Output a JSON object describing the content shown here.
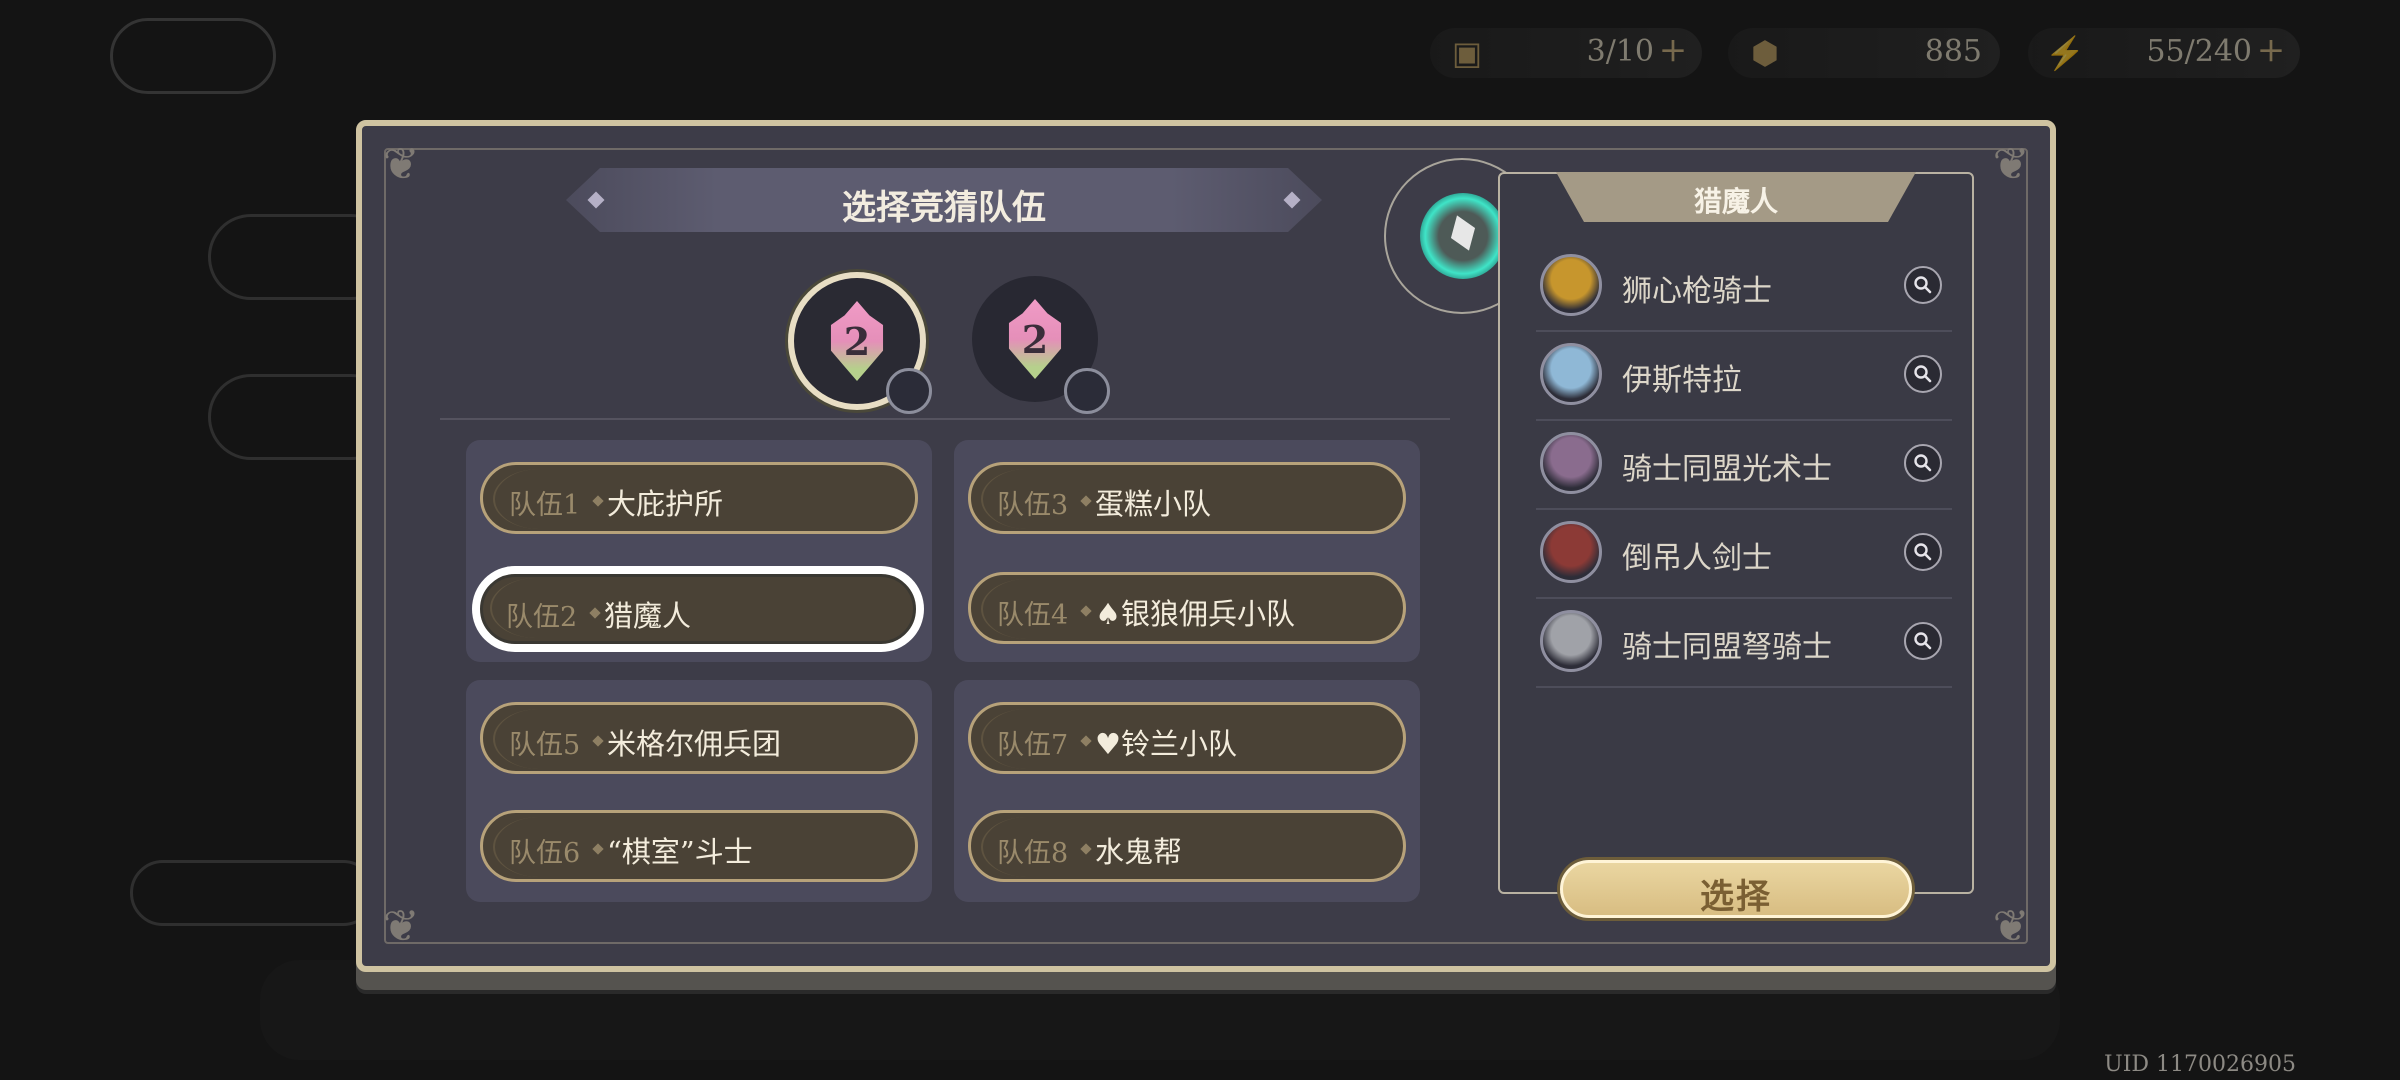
{
  "title": "选择竞猜队伍",
  "resources": [
    {
      "icon": "card-icon",
      "value": "3/10"
    },
    {
      "icon": "coin-icon",
      "value": "885"
    },
    {
      "icon": "lightning-icon",
      "value": "55/240"
    }
  ],
  "badges": [
    {
      "number": "2"
    },
    {
      "number": "2"
    }
  ],
  "teams": [
    {
      "no": "队伍1",
      "name": "大庇护所"
    },
    {
      "no": "队伍2",
      "name": "猎魔人"
    },
    {
      "no": "队伍3",
      "name": "蛋糕小队"
    },
    {
      "no": "队伍4",
      "name": "♠银狼佣兵小队"
    },
    {
      "no": "队伍5",
      "name": "米格尔佣兵团"
    },
    {
      "no": "队伍6",
      "name": "“棋室”斗士"
    },
    {
      "no": "队伍7",
      "name": "♥铃兰小队"
    },
    {
      "no": "队伍8",
      "name": "水鬼帮"
    }
  ],
  "selected_team_index": 1,
  "side_panel": {
    "title": "猎魔人",
    "members": [
      {
        "name": "狮心枪骑士",
        "color": "#c7962d"
      },
      {
        "name": "伊斯特拉",
        "color": "#8fb8d6"
      },
      {
        "name": "骑士同盟光术士",
        "color": "#8a6c8e"
      },
      {
        "name": "倒吊人剑士",
        "color": "#8c3a36"
      },
      {
        "name": "骑士同盟弩骑士",
        "color": "#a0a2a8"
      }
    ],
    "select_label": "选择"
  },
  "uid": "UID 1170026905",
  "colors": {
    "accent": "#d8bd82",
    "panel": "#3d3c48",
    "glow": "#3fe4c7"
  }
}
